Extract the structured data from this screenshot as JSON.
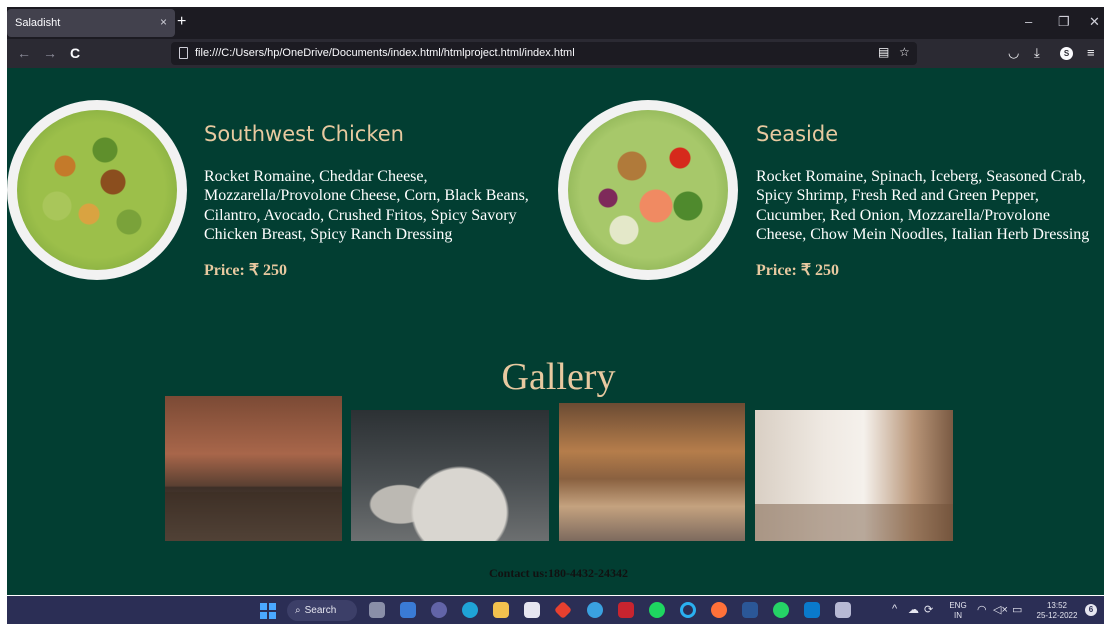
{
  "browser": {
    "tab_title": "Saladisht",
    "tab_close": "×",
    "new_tab": "+",
    "url": "file:///C:/Users/hp/OneDrive/Documents/index.html/htmlproject.html/index.html",
    "back": "←",
    "forward": "→",
    "reload": "C",
    "minimize": "–",
    "restore": "❐",
    "close": "✕"
  },
  "menu": {
    "items": [
      {
        "title": "Southwest Chicken",
        "description_lines": [
          "Rocket Romaine, Cheddar Cheese,",
          "Mozzarella/Provolone Cheese, Corn, Black Beans,",
          "Cilantro, Avocado, Crushed Fritos, Spicy Savory",
          "Chicken Breast, Spicy Ranch Dressing"
        ],
        "price": "Price: ₹ 250"
      },
      {
        "title": "Seaside",
        "description_lines": [
          "Rocket Romaine, Spinach, Iceberg, Seasoned Crab,",
          "Spicy Shrimp, Fresh Red and Green Pepper,",
          "Cucumber, Red Onion, Mozzarella/Provolone",
          "Cheese, Chow Mein Noodles, Italian Herb Dressing"
        ],
        "price": "Price: ₹ 250"
      }
    ]
  },
  "gallery": {
    "title": "Gallery"
  },
  "contact": "Contact us:180-4432-24342",
  "taskbar": {
    "search_label": "Search",
    "language": "ENG",
    "region": "IN",
    "time": "13:52",
    "date": "25-12-2022",
    "notification_count": "6"
  },
  "colors": {
    "page_bg": "#023e32",
    "accent": "#e8c9a0",
    "taskbar_bg": "#2b2e55"
  }
}
